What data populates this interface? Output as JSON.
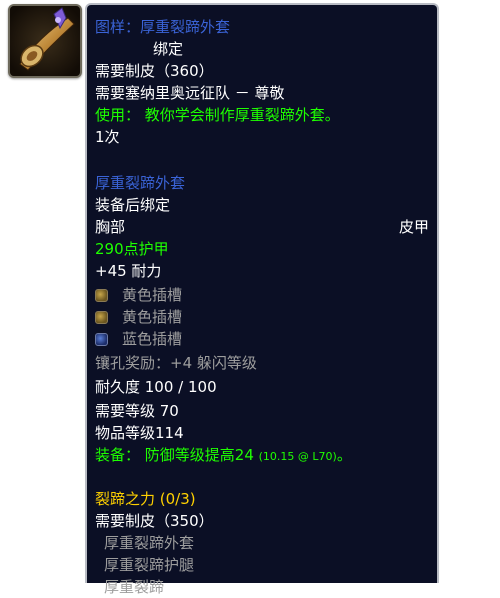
{
  "recipe_title": "图样：厚重裂蹄外套",
  "bind_partial": "绑定",
  "req_skill": "需要制皮（360）",
  "req_faction": "需要塞纳里奥远征队 － 尊敬",
  "use_text": "使用： 教你学会制作厚重裂蹄外套。",
  "charges": "1次",
  "item_name": "厚重裂蹄外套",
  "binding": "装备后绑定",
  "slot": "胸部",
  "armor_type": "皮甲",
  "armor": "290点护甲",
  "stamina": "+45 耐力",
  "sockets": [
    {
      "color": "yellow",
      "label": "黄色插槽"
    },
    {
      "color": "yellow",
      "label": "黄色插槽"
    },
    {
      "color": "blue",
      "label": "蓝色插槽"
    }
  ],
  "socket_bonus": "镶孔奖励：+4 躲闪等级",
  "durability": "耐久度 100 / 100",
  "req_level": "需要等级 70",
  "item_level": "物品等级114",
  "equip_prefix": "装备：",
  "equip_effect": " 防御等级提高24 ",
  "equip_detail": "(10.15 @ L70)",
  "equip_suffix": "。",
  "set_name": "裂蹄之力 (0/3)",
  "set_req": "需要制皮（350）",
  "set_items": [
    "厚重裂蹄外套",
    "厚重裂蹄护腿",
    "厚重裂蹄"
  ],
  "icon": "recipe-scroll-icon"
}
